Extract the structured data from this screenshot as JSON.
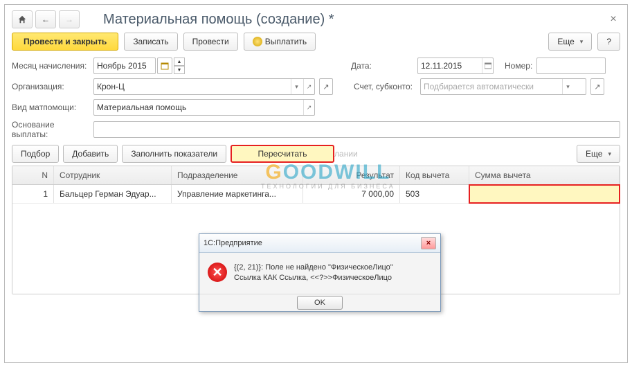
{
  "window": {
    "title": "Материальная помощь (создание) *"
  },
  "toolbar": {
    "post_close": "Провести и закрыть",
    "write": "Записать",
    "post": "Провести",
    "pay": "Выплатить",
    "more": "Еще",
    "help": "?"
  },
  "form": {
    "month_label": "Месяц начисления:",
    "month_value": "Ноябрь 2015",
    "date_label": "Дата:",
    "date_value": "12.11.2015",
    "number_label": "Номер:",
    "number_value": "",
    "org_label": "Организация:",
    "org_value": "Крон-Ц",
    "account_label": "Счет, субконто:",
    "account_placeholder": "Подбирается автоматически",
    "type_label": "Вид матпомощи:",
    "type_value": "Материальная помощь",
    "basis_label": "Основание выплаты:",
    "basis_value": ""
  },
  "tbl_toolbar": {
    "pick": "Подбор",
    "add": "Добавить",
    "fill": "Заполнить показатели",
    "recalc": "Пересчитать",
    "recalc_suffix": "лании",
    "more": "Еще"
  },
  "columns": {
    "n": "N",
    "emp": "Сотрудник",
    "dep": "Подразделение",
    "res": "Результат",
    "code": "Код вычета",
    "sum": "Сумма вычета"
  },
  "rows": [
    {
      "n": "1",
      "emp": "Бальцер Герман Эдуар...",
      "dep": "Управление маркетинга...",
      "res": "7 000,00",
      "code": "503",
      "sum": ""
    }
  ],
  "dialog": {
    "title": "1С:Предприятие",
    "line1": "{(2, 21)}: Поле не найдено \"ФизическоеЛицо\"",
    "line2": "Ссылка КАК Ссылка, <<?>>ФизическоеЛицо",
    "ok": "OK"
  },
  "watermark": {
    "brand_g": "G",
    "brand_rest": "OODWILL",
    "tag": "ТЕХНОЛОГИИ  ДЛЯ  БИЗНЕСА"
  },
  "chart_data": {
    "type": "table",
    "columns": [
      "N",
      "Сотрудник",
      "Подразделение",
      "Результат",
      "Код вычета",
      "Сумма вычета"
    ],
    "rows": [
      [
        1,
        "Бальцер Герман Эдуар...",
        "Управление маркетинга...",
        7000.0,
        "503",
        null
      ]
    ]
  }
}
